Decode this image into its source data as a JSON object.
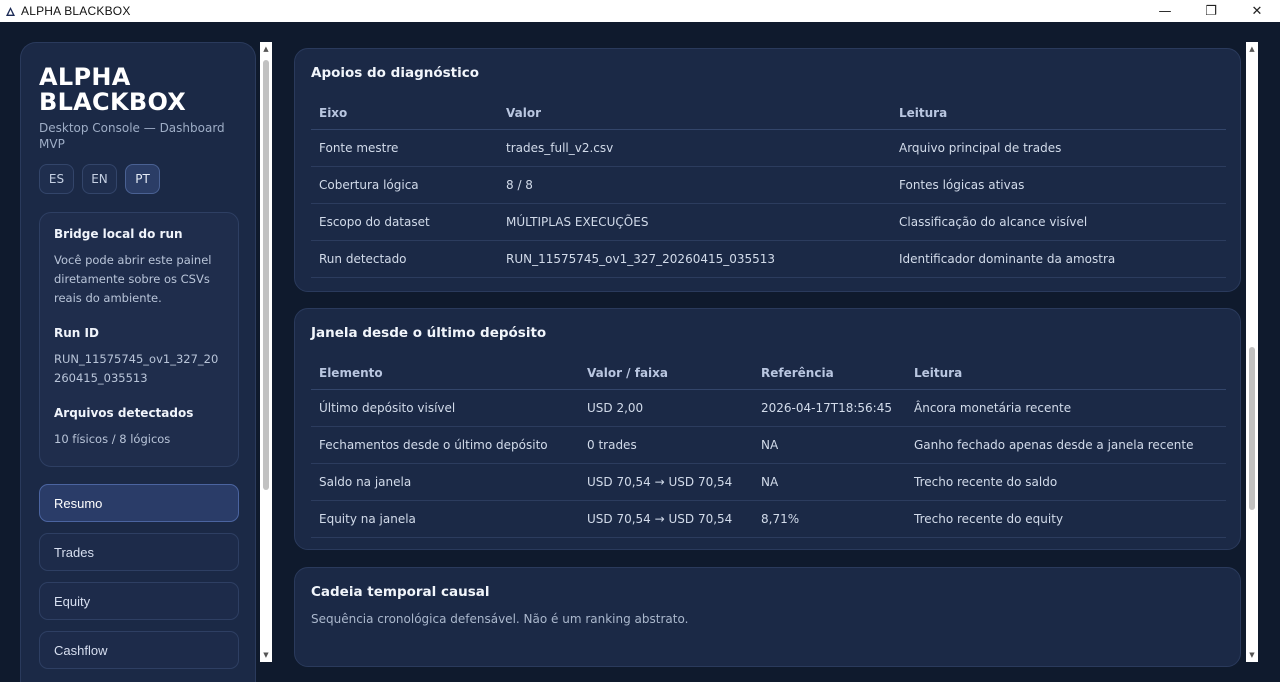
{
  "window": {
    "title": "ALPHA BLACKBOX",
    "minimize": "—",
    "maximize": "❐",
    "close": "✕"
  },
  "sidebar": {
    "brand": "ALPHA BLACKBOX",
    "subtitle": "Desktop Console — Dashboard MVP",
    "languages": [
      "ES",
      "EN",
      "PT"
    ],
    "active_language": "PT",
    "bridge": {
      "title": "Bridge local do run",
      "text": "Você pode abrir este painel diretamente sobre os CSVs reais do ambiente.",
      "run_id_label": "Run ID",
      "run_id_value": "RUN_11575745_ov1_327_20260415_035513",
      "files_label": "Arquivos detectados",
      "files_value": "10 físicos / 8 lógicos"
    },
    "nav": [
      {
        "label": "Resumo",
        "active": true
      },
      {
        "label": "Trades",
        "active": false
      },
      {
        "label": "Equity",
        "active": false
      },
      {
        "label": "Cashflow",
        "active": false
      }
    ]
  },
  "diag": {
    "title": "Apoios do diagnóstico",
    "headers": [
      "Eixo",
      "Valor",
      "Leitura"
    ],
    "rows": [
      [
        "Fonte mestre",
        "trades_full_v2.csv",
        "Arquivo principal de trades"
      ],
      [
        "Cobertura lógica",
        "8 / 8",
        "Fontes lógicas ativas"
      ],
      [
        "Escopo do dataset",
        "MÚLTIPLAS EXECUÇÕES",
        "Classificação do alcance visível"
      ],
      [
        "Run detectado",
        "RUN_11575745_ov1_327_20260415_035513",
        "Identificador dominante da amostra"
      ]
    ]
  },
  "window_deposit": {
    "title": "Janela desde o último depósito",
    "headers": [
      "Elemento",
      "Valor / faixa",
      "Referência",
      "Leitura"
    ],
    "rows": [
      [
        "Último depósito visível",
        "USD 2,00",
        "2026-04-17T18:56:45",
        "Âncora monetária recente"
      ],
      [
        "Fechamentos desde o último depósito",
        "0 trades",
        "NA",
        "Ganho fechado apenas desde a janela recente"
      ],
      [
        "Saldo na janela",
        "USD 70,54 → USD 70,54",
        "NA",
        "Trecho recente do saldo"
      ],
      [
        "Equity na janela",
        "USD 70,54 → USD 70,54",
        "8,71%",
        "Trecho recente do equity"
      ]
    ]
  },
  "causal": {
    "title": "Cadeia temporal causal",
    "subtitle": "Sequência cronológica defensável. Não é um ranking abstrato."
  },
  "scrollbar": {
    "up": "▲",
    "down": "▼"
  },
  "colors": {
    "background": "#0f1a2d",
    "card": "#1b2946",
    "accent": "#2a3c68"
  }
}
